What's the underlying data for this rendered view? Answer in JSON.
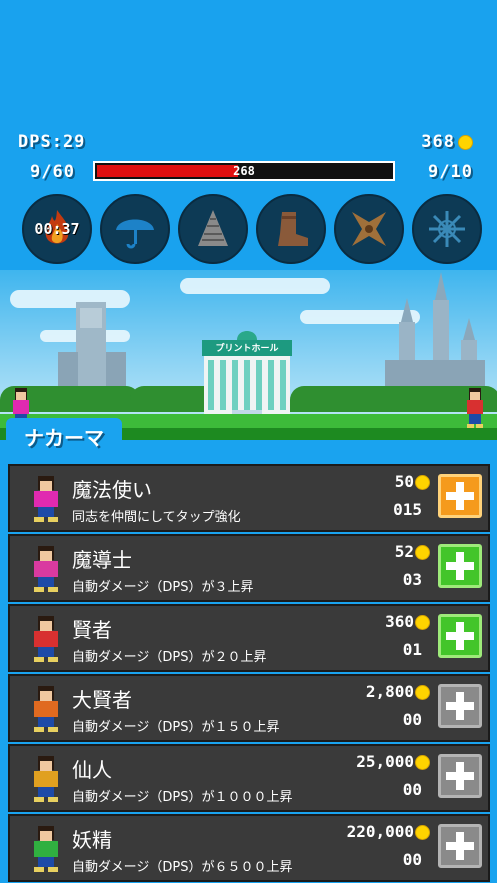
{
  "hud": {
    "dps": "DPS:29",
    "gold": "368",
    "stage_progress": "9/60",
    "stage_right": "9/10",
    "enemy_hp_text": "268",
    "enemy_hp_fraction": 0.48
  },
  "skills": [
    {
      "icon": "fire-icon",
      "timer": "00:37"
    },
    {
      "icon": "umbrella-icon",
      "timer": ""
    },
    {
      "icon": "drill-icon",
      "timer": ""
    },
    {
      "icon": "boot-icon",
      "timer": ""
    },
    {
      "icon": "shuriken-icon",
      "timer": ""
    },
    {
      "icon": "snowflake-icon",
      "timer": ""
    }
  ],
  "scene": {
    "shop_sign": "プリントホール"
  },
  "tab": {
    "label": "ナカーマ"
  },
  "allies": [
    {
      "name": "魔法使い",
      "desc": "同志を仲間にしてタップ強化",
      "cost": "50",
      "level": "015",
      "button": "orange",
      "color": "#e02ab0"
    },
    {
      "name": "魔導士",
      "desc": "自動ダメージ（DPS）が３上昇",
      "cost": "52",
      "level": "03",
      "button": "green",
      "color": "#d93aa0"
    },
    {
      "name": "賢者",
      "desc": "自動ダメージ（DPS）が２０上昇",
      "cost": "360",
      "level": "01",
      "button": "green",
      "color": "#d83030"
    },
    {
      "name": "大賢者",
      "desc": "自動ダメージ（DPS）が１５０上昇",
      "cost": "2,800",
      "level": "00",
      "button": "gray",
      "color": "#e06a20"
    },
    {
      "name": "仙人",
      "desc": "自動ダメージ（DPS）が１０００上昇",
      "cost": "25,000",
      "level": "00",
      "button": "gray",
      "color": "#e0a020"
    },
    {
      "name": "妖精",
      "desc": "自動ダメージ（DPS）が６５００上昇",
      "cost": "220,000",
      "level": "00",
      "button": "gray",
      "color": "#30b040"
    }
  ]
}
